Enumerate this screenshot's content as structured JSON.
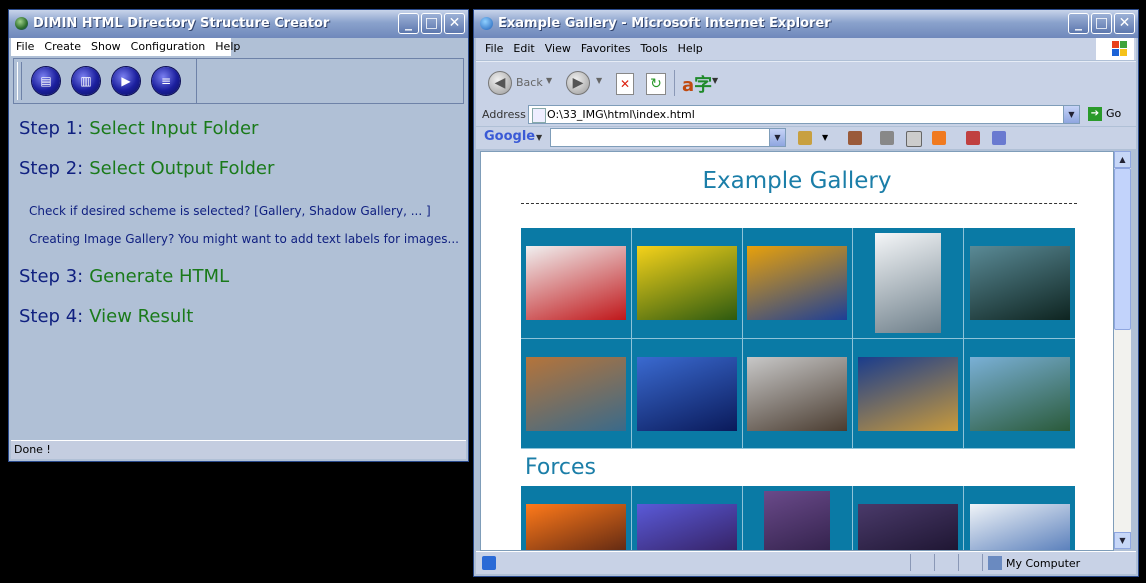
{
  "left_window": {
    "title": "DIMIN HTML Directory Structure Creator",
    "menu": [
      "File",
      "Create",
      "Show",
      "Configuration",
      "Help"
    ],
    "toolbar_icons": [
      "open-folder-icon",
      "output-folder-icon",
      "play-icon",
      "generate-icon"
    ],
    "steps": [
      {
        "label": "Step 1:",
        "action": "Select Input Folder"
      },
      {
        "label": "Step 2:",
        "action": "Select Output Folder"
      },
      {
        "label": "Step 3:",
        "action": "Generate HTML"
      },
      {
        "label": "Step 4:",
        "action": "View Result"
      }
    ],
    "hints": [
      "Check if desired scheme is selected?  [Gallery, Shadow Gallery, ... ]",
      "Creating Image Gallery? You might want to add text labels for images..."
    ],
    "status": "Done !"
  },
  "right_window": {
    "title": "Example Gallery - Microsoft Internet Explorer",
    "menu": [
      "File",
      "Edit",
      "View",
      "Favorites",
      "Tools",
      "Help"
    ],
    "back_label": "Back",
    "address_label": "Address",
    "address_value": "O:\\33_IMG\\html\\index.html",
    "go_label": "Go",
    "google_label": "Google",
    "page_title": "Example Gallery",
    "section_heading": "Forces",
    "status_zone": "My Computer",
    "gallery_1": [
      {
        "name": "rose-photo",
        "c1": "#f0f0f0",
        "c2": "#c0171a"
      },
      {
        "name": "tulips-photo",
        "c1": "#f5d21a",
        "c2": "#2d5a10"
      },
      {
        "name": "sunflower-photo",
        "c1": "#e8a10a",
        "c2": "#1d3f96"
      },
      {
        "name": "mountain-clouds-photo",
        "c1": "#f4f6f8",
        "c2": "#6e7f8a"
      },
      {
        "name": "forest-photo",
        "c1": "#5a8a96",
        "c2": "#0e2420"
      },
      {
        "name": "canyon-river-photo",
        "c1": "#b5743a",
        "c2": "#3a6a8a"
      },
      {
        "name": "snow-village-photo",
        "c1": "#3a6ad0",
        "c2": "#0a1a5a"
      },
      {
        "name": "half-dome-photo",
        "c1": "#c8c8c8",
        "c2": "#4a3c30"
      },
      {
        "name": "lightning-field-photo",
        "c1": "#1a3c8c",
        "c2": "#c89a3c"
      },
      {
        "name": "waterfall-rainbow-photo",
        "c1": "#7ab0d6",
        "c2": "#2a5a3a"
      }
    ],
    "gallery_2": [
      {
        "name": "lava-photo",
        "c1": "#ff7a1a",
        "c2": "#301010"
      },
      {
        "name": "storm-sky-photo",
        "c1": "#5a5ad8",
        "c2": "#2a1040"
      },
      {
        "name": "lightning-photo-1",
        "c1": "#6a4a8a",
        "c2": "#1a1030"
      },
      {
        "name": "lightning-photo-2",
        "c1": "#4a3a6a",
        "c2": "#100a20"
      },
      {
        "name": "clouds-photo",
        "c1": "#f0f4f8",
        "c2": "#2a5aa8"
      }
    ]
  }
}
